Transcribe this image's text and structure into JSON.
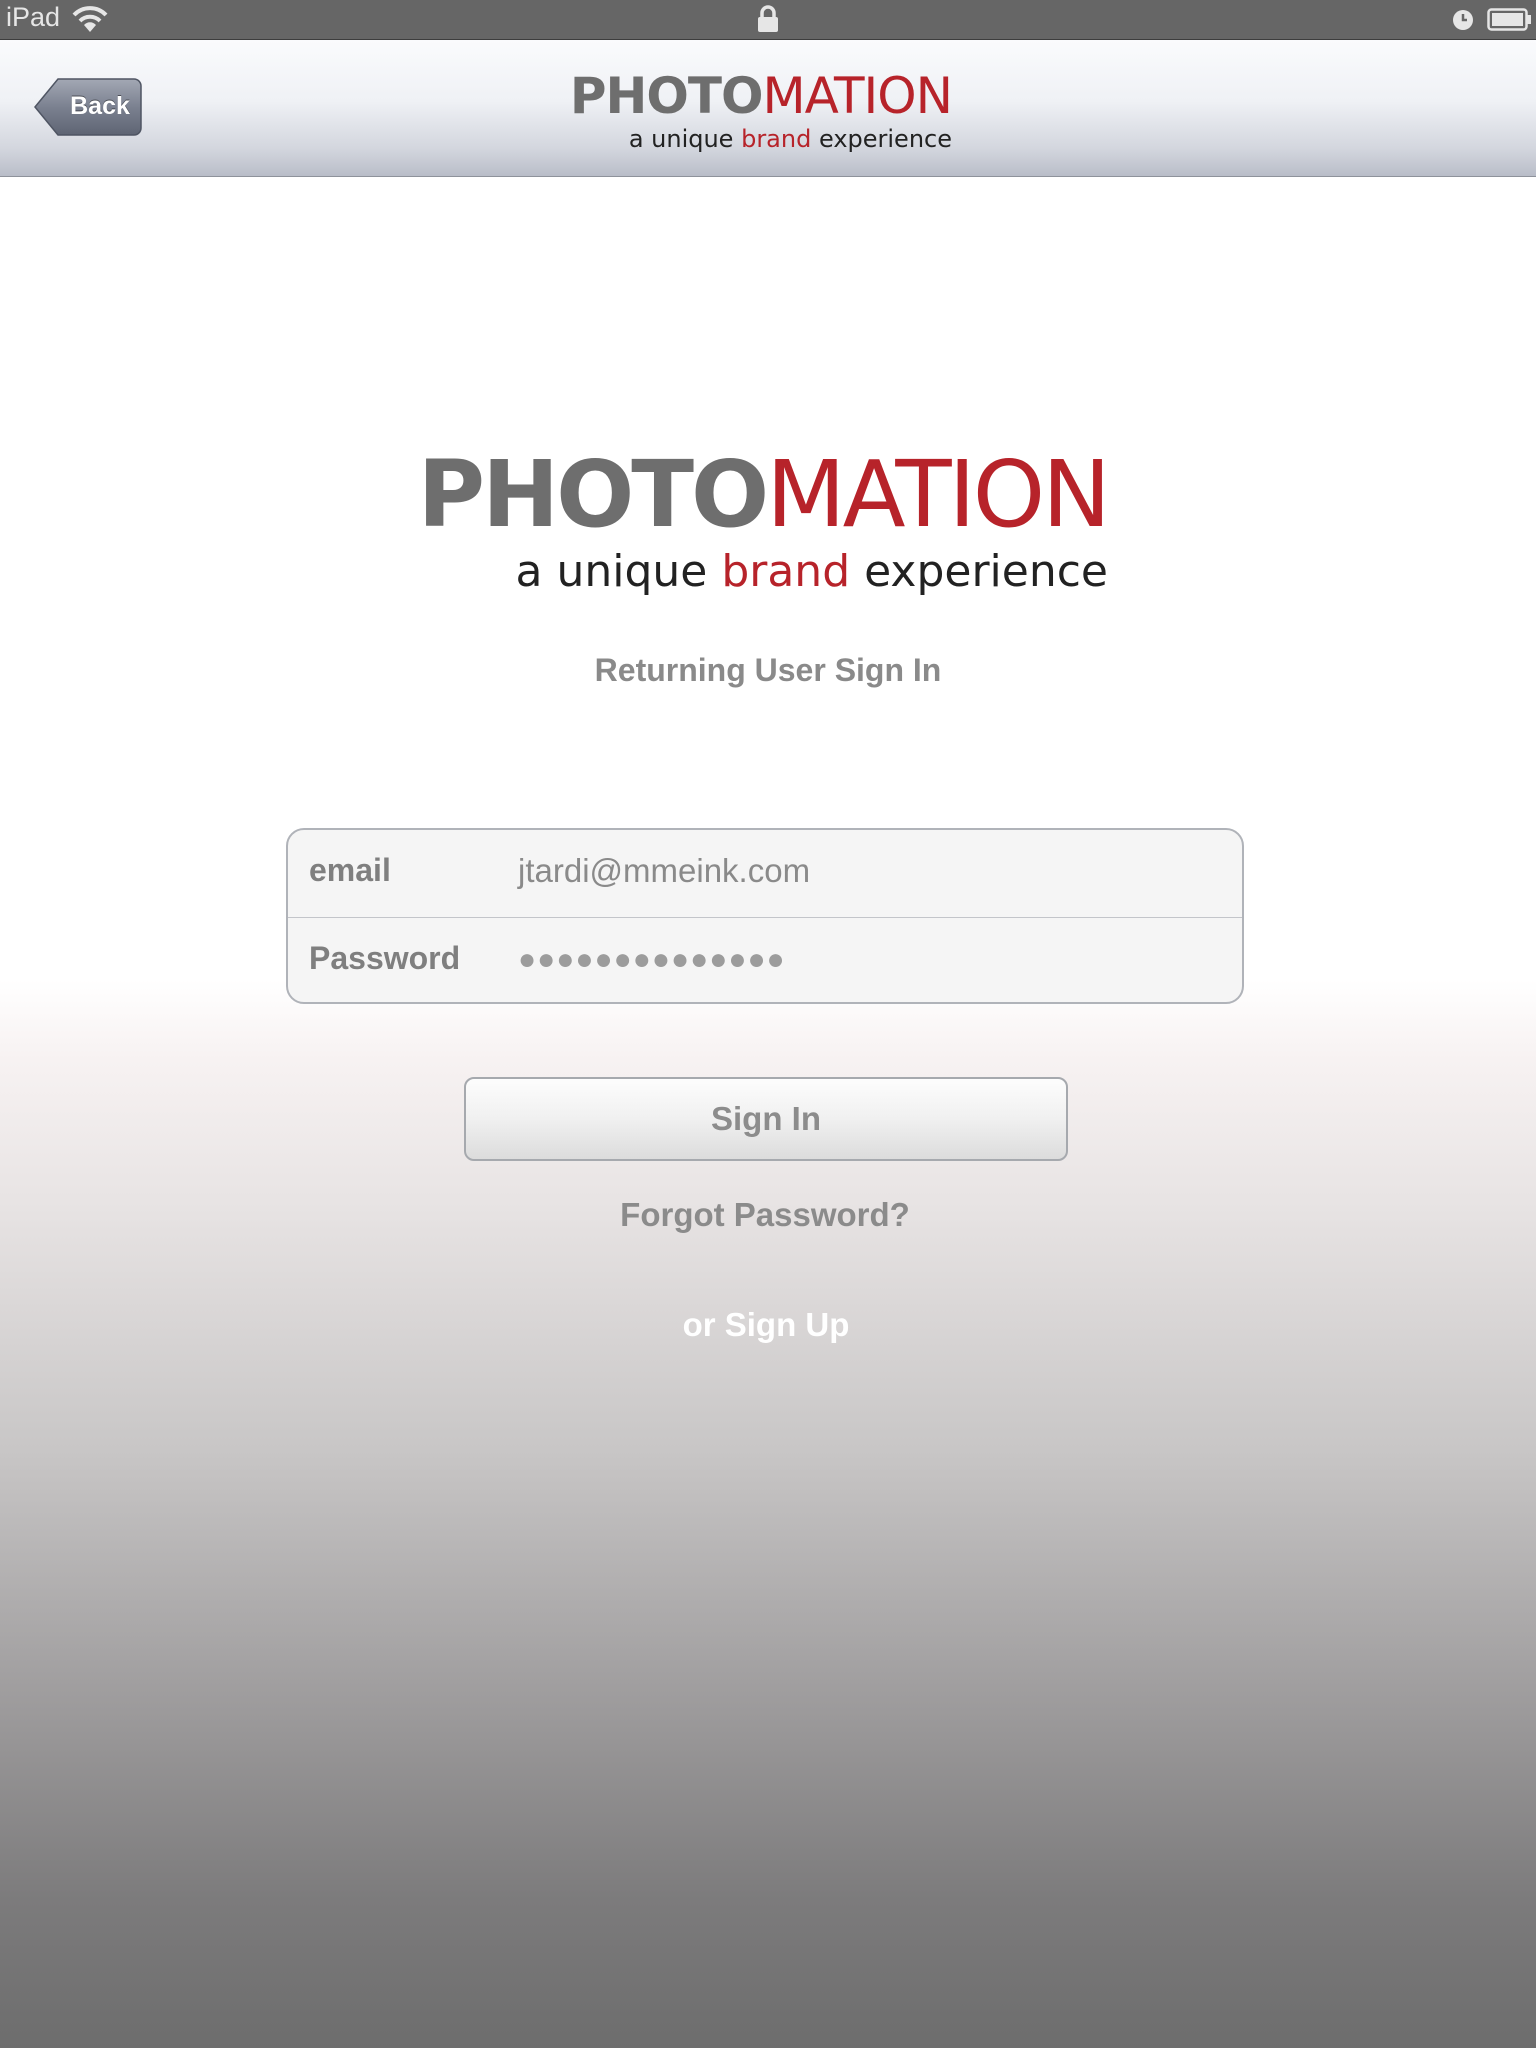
{
  "status_bar": {
    "device": "iPad",
    "icons": [
      "wifi-icon",
      "lock-icon",
      "clock-icon",
      "battery-icon"
    ]
  },
  "nav": {
    "back_label": "Back",
    "logo": {
      "word_part1": "PHOTO",
      "word_part2": "MATION",
      "tag_part1": "a unique ",
      "tag_part2": "brand",
      "tag_part3": " experience"
    }
  },
  "main": {
    "logo": {
      "word_part1": "PHOTO",
      "word_part2": "MATION",
      "tag_part1": "a unique ",
      "tag_part2": "brand",
      "tag_part3": " experience"
    },
    "subtitle": "Returning User Sign In",
    "form": {
      "email_label": "email",
      "email_value": "jtardi@mmeink.com",
      "password_label": "Password",
      "password_value": "●●●●●●●●●●●●●●"
    },
    "signin_label": "Sign In",
    "forgot_label": "Forgot Password?",
    "signup_label": "or Sign Up"
  },
  "colors": {
    "brand_grey": "#6e6e6e",
    "brand_red": "#b7232a",
    "status_bar": "#666666"
  }
}
